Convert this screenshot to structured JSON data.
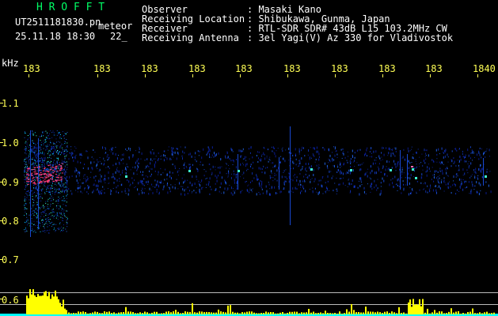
{
  "header": {
    "brand": "H R O F F T",
    "filename": "UT2511181830.pn",
    "file_tag": "meteor",
    "date": "25.11.18 18:30",
    "value": "22_"
  },
  "info": {
    "labels": [
      "Observer",
      "Receiving Location",
      "Receiver",
      "Receiving Antenna"
    ],
    "values": [
      ": Masaki Kano",
      ": Shibukawa, Gunma, Japan",
      ": RTL-SDR SDR# 43dB L15 103.2MHz CW",
      ": 3el Yagi(V) Az 330 for Vladivostok"
    ]
  },
  "axes": {
    "y_unit": "kHz",
    "y_ticks": [
      "1.1",
      "1.0",
      "0.9",
      "0.8",
      "0.7",
      "0.6"
    ],
    "time_ticks": [
      "183",
      "183",
      "183",
      "183",
      "183",
      "183",
      "183",
      "183",
      "183",
      "1840"
    ]
  },
  "colors": {
    "background": "#000000",
    "header_green": "#00ff66",
    "label_yellow": "#ffff55",
    "signal_pink": "#ff3c78",
    "bar_yellow": "#ffff00",
    "baseline_cyan": "#00ffff"
  }
}
